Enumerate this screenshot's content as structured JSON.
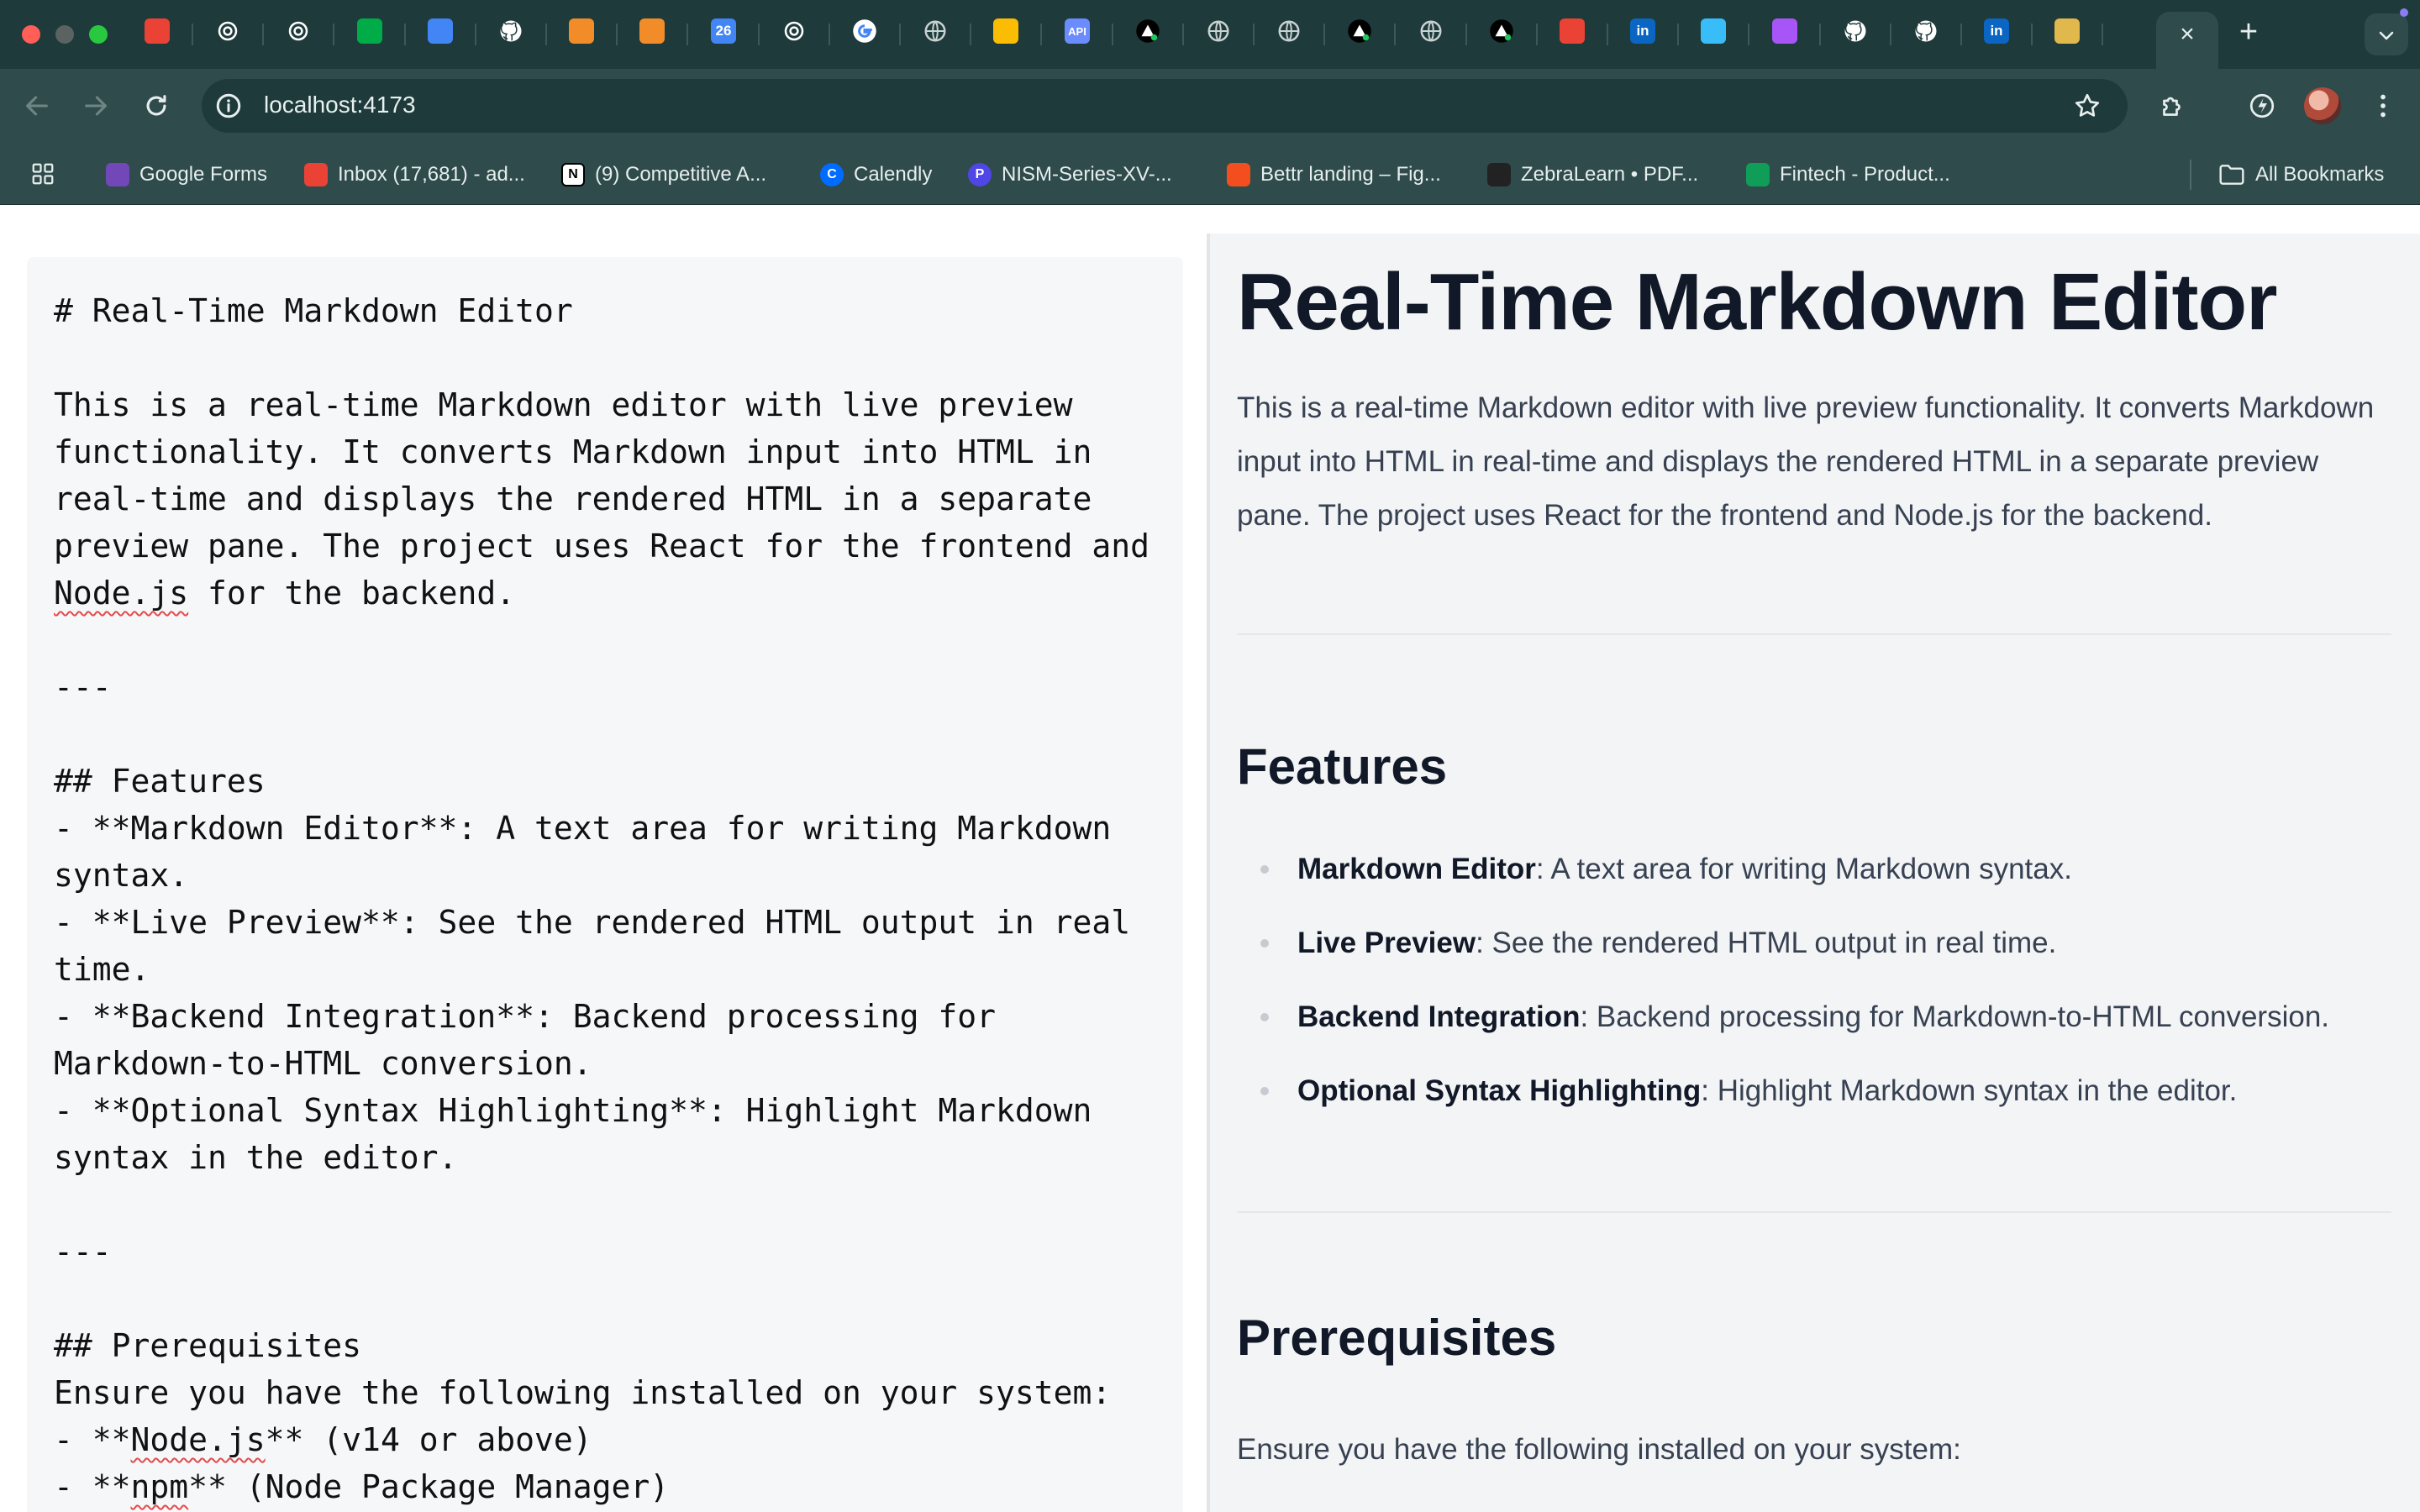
{
  "browser": {
    "url": "localhost:4173",
    "tabs": [
      {
        "icon": "gmail-icon",
        "color": "#ea4335"
      },
      {
        "icon": "openai-icon",
        "color": "#ffffff"
      },
      {
        "icon": "openai-icon",
        "color": "#ffffff"
      },
      {
        "icon": "google-meet-icon",
        "color": "#00ac47"
      },
      {
        "icon": "google-docs-icon",
        "color": "#4285f4"
      },
      {
        "icon": "github-icon",
        "color": "#ffffff"
      },
      {
        "icon": "bookmark-orange-icon",
        "color": "#f28c28"
      },
      {
        "icon": "bookmark-orange-icon",
        "color": "#f28c28"
      },
      {
        "icon": "google-calendar-icon",
        "color": "#4285f4",
        "label": "26"
      },
      {
        "icon": "openai-icon",
        "color": "#ffffff"
      },
      {
        "icon": "google-icon",
        "color": "#ffffff"
      },
      {
        "icon": "globe-icon",
        "color": "#c9d2d2"
      },
      {
        "icon": "google-cloud-icon",
        "color": "#fbbc04"
      },
      {
        "icon": "api-icon",
        "color": "#6b8cff",
        "label": "API"
      },
      {
        "icon": "vercel-icon",
        "color": "#ffffff"
      },
      {
        "icon": "globe-icon",
        "color": "#c9d2d2"
      },
      {
        "icon": "globe-icon",
        "color": "#c9d2d2"
      },
      {
        "icon": "vercel-icon",
        "color": "#ffffff"
      },
      {
        "icon": "globe-icon",
        "color": "#c9d2d2"
      },
      {
        "icon": "vercel-icon",
        "color": "#ffffff"
      },
      {
        "icon": "gmail-icon",
        "color": "#ea4335"
      },
      {
        "icon": "linkedin-icon",
        "color": "#0a66c2",
        "label": "in"
      },
      {
        "icon": "tailwind-icon",
        "color": "#38bdf8"
      },
      {
        "icon": "vite-icon",
        "color": "#a855f7"
      },
      {
        "icon": "github-icon",
        "color": "#ffffff"
      },
      {
        "icon": "github-icon",
        "color": "#ffffff"
      },
      {
        "icon": "linkedin-icon",
        "color": "#0a66c2",
        "label": "in"
      },
      {
        "icon": "chrome-profile-icon",
        "color": "#e0b84c"
      },
      {
        "icon": "github-icon",
        "color": "#1e3a3a"
      }
    ],
    "bookmarks": [
      {
        "label": "Google Forms",
        "icon": "google-forms-icon",
        "color": "#7248b9"
      },
      {
        "label": "Inbox (17,681) - ad...",
        "icon": "gmail-icon",
        "color": "#ea4335"
      },
      {
        "label": "(9) Competitive A...",
        "icon": "notion-icon",
        "color": "#ffffff"
      },
      {
        "label": "Calendly",
        "icon": "calendly-icon",
        "color": "#006bff"
      },
      {
        "label": "NISM-Series-XV-...",
        "icon": "pdf-p-icon",
        "color": "#4f46e5"
      },
      {
        "label": "Bettr landing – Fig...",
        "icon": "figma-icon",
        "color": "#f24e1e"
      },
      {
        "label": "ZebraLearn • PDF...",
        "icon": "zebralearn-icon",
        "color": "#222222"
      },
      {
        "label": "Fintech - Product...",
        "icon": "google-sheets-icon",
        "color": "#0f9d58"
      }
    ],
    "all_bookmarks": "All Bookmarks"
  },
  "editor": {
    "title_line": "# Real-Time Markdown Editor",
    "intro_pre": "This is a real-time Markdown editor with live preview functionality. It converts Markdown input into HTML in real-time and displays the rendered HTML in a separate preview pane. The project uses React for the frontend and ",
    "intro_word": "Node.js",
    "intro_post": " for the backend.",
    "rule": "---",
    "features_heading": "## Features",
    "feature_lines": [
      "- **Markdown Editor**: A text area for writing Markdown syntax.",
      "- **Live Preview**: See the rendered HTML output in real time.",
      "- **Backend Integration**: Backend processing for Markdown-to-HTML conversion.",
      "- **Optional Syntax Highlighting**: Highlight Markdown syntax in the editor."
    ],
    "rule2": "---",
    "prereq_heading": "## Prerequisites",
    "prereq_intro": "Ensure you have the following installed on your system:",
    "prereq_line1_pre": "- **",
    "prereq_line1_word": "Node.js",
    "prereq_line1_post": "** (v14 or above)",
    "prereq_line2_pre": "- **",
    "prereq_line2_word": "npm",
    "prereq_line2_post": "** (Node Package Manager)"
  },
  "preview": {
    "title": "Real-Time Markdown Editor",
    "intro": "This is a real-time Markdown editor with live preview functionality. It converts Markdown input into HTML in real-time and displays the rendered HTML in a separate preview pane. The project uses React for the frontend and Node.js for the backend.",
    "features_heading": "Features",
    "features": [
      {
        "name": "Markdown Editor",
        "desc": ": A text area for writing Markdown syntax."
      },
      {
        "name": "Live Preview",
        "desc": ": See the rendered HTML output in real time."
      },
      {
        "name": "Backend Integration",
        "desc": ": Backend processing for Markdown-to-HTML conversion."
      },
      {
        "name": "Optional Syntax Highlighting",
        "desc": ": Highlight Markdown syntax in the editor."
      }
    ],
    "prereq_heading": "Prerequisites",
    "prereq_intro": "Ensure you have the following installed on your system:"
  }
}
